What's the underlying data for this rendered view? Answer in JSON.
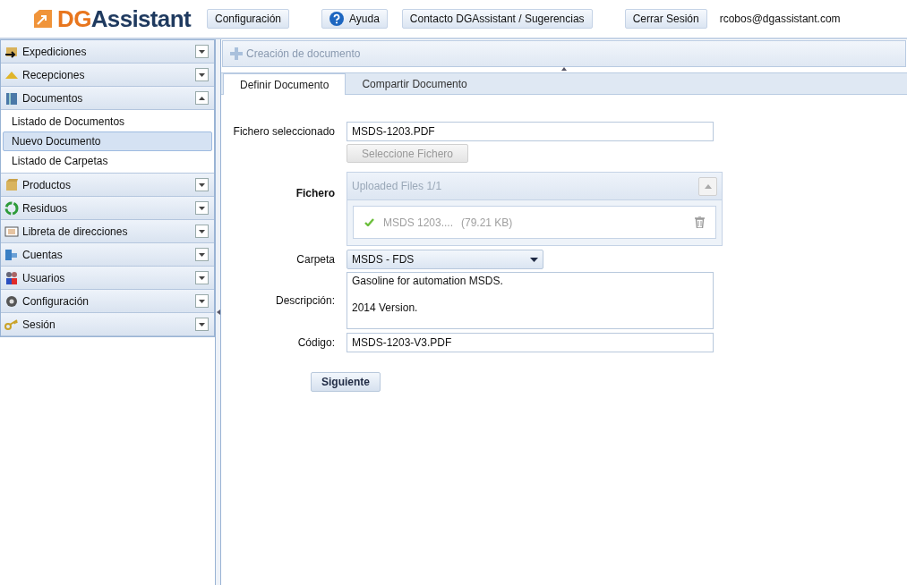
{
  "logo": {
    "part_1": "DG",
    "part_2": "Assistant"
  },
  "header_buttons": [
    {
      "label": "Configuración",
      "kind": "plain"
    },
    {
      "label": "Ayuda",
      "kind": "help"
    },
    {
      "label": "Contacto DGAssistant / Sugerencias",
      "kind": "plain"
    },
    {
      "label": "Cerrar Sesión",
      "kind": "plain"
    }
  ],
  "user_email": "rcobos@dgassistant.com",
  "sidebar": {
    "sections": [
      {
        "label": "Expediciones",
        "expanded": false
      },
      {
        "label": "Recepciones",
        "expanded": false
      },
      {
        "label": "Documentos",
        "expanded": true,
        "children": [
          {
            "label": "Listado de Documentos",
            "selected": false
          },
          {
            "label": "Nuevo Documento",
            "selected": true
          },
          {
            "label": "Listado de Carpetas",
            "selected": false
          }
        ]
      },
      {
        "label": "Productos",
        "expanded": false
      },
      {
        "label": "Residuos",
        "expanded": false
      },
      {
        "label": "Libreta de direcciones",
        "expanded": false
      },
      {
        "label": "Cuentas",
        "expanded": false
      },
      {
        "label": "Usuarios",
        "expanded": false
      },
      {
        "label": "Configuración",
        "expanded": false
      },
      {
        "label": "Sesión",
        "expanded": false
      }
    ]
  },
  "toolbar": {
    "title": "Creación de documento"
  },
  "tabs": [
    {
      "label": "Definir Documento",
      "selected": true
    },
    {
      "label": "Compartir Documento",
      "selected": false
    }
  ],
  "form": {
    "selected_file": {
      "label": "Fichero seleccionado",
      "value": "MSDS-1203.PDF",
      "button": "Seleccione Fichero"
    },
    "file": {
      "label": "Fichero",
      "panel_title": "Uploaded Files 1/1",
      "files": [
        {
          "name": "MSDS 1203....",
          "size": "(79.21 KB)",
          "uploaded": true
        }
      ]
    },
    "folder": {
      "label": "Carpeta",
      "value": "MSDS - FDS"
    },
    "description": {
      "label": "Descripción:",
      "value": "Gasoline for automation MSDS.\n\n2014 Version."
    },
    "code": {
      "label": "Código:",
      "value": "MSDS-1203-V3.PDF"
    },
    "submit": "Siguiente"
  }
}
